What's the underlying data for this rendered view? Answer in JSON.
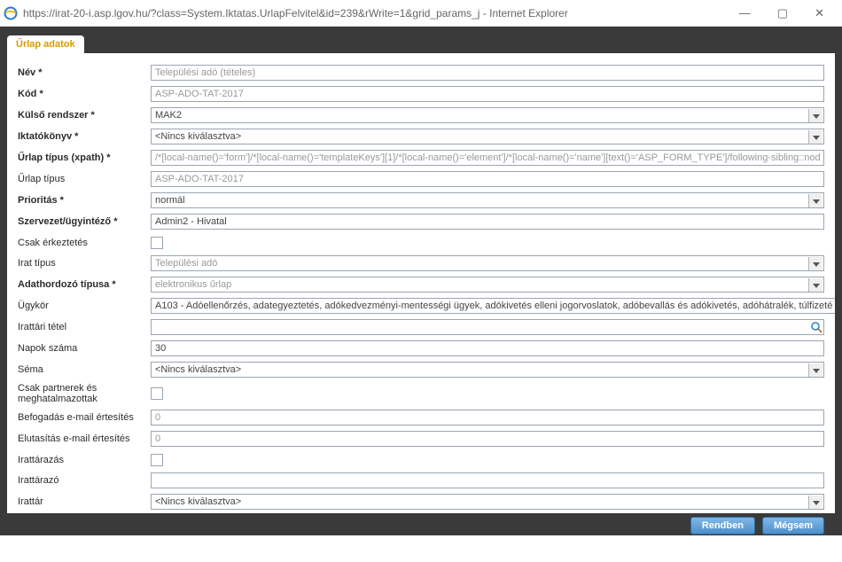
{
  "window": {
    "url_title": "https://irat-20-i.asp.lgov.hu/?class=System.Iktatas.UrlapFelvitel&id=239&rWrite=1&grid_params_j - Internet Explorer"
  },
  "tab": {
    "label": "Űrlap adatok"
  },
  "fields": {
    "nev": {
      "label": "Név *",
      "value": "Települési adó (tételes)"
    },
    "kod": {
      "label": "Kód *",
      "value": "ASP-ADO-TAT-2017"
    },
    "kulso": {
      "label": "Külső rendszer *",
      "value": "MAK2"
    },
    "iktatokonyv": {
      "label": "Iktatókönyv *",
      "value": "<Nincs kiválasztva>"
    },
    "urlap_xpath": {
      "label": "Űrlap típus (xpath) *",
      "value": "/*[local-name()='form']/*[local-name()='templateKeys'][1]/*[local-name()='element']/*[local-name()='name'][text()='ASP_FORM_TYPE']/following-sibling::node()"
    },
    "urlap_tipus": {
      "label": "Űrlap típus",
      "value": "ASP-ADO-TAT-2017"
    },
    "prioritas": {
      "label": "Prioritás *",
      "value": "normál"
    },
    "szervezet": {
      "label": "Szervezet/ügyintéző *",
      "value": "Admin2 - Hivatal"
    },
    "csak_erk": {
      "label": "Csak érkeztetés"
    },
    "irat_tipus": {
      "label": "Irat típus",
      "value": "Települési adó"
    },
    "adath": {
      "label": "Adathordozó típusa *",
      "value": "elektronikus űrlap"
    },
    "ugykor": {
      "label": "Ügykör",
      "value": "A103 - Adóellenőrzés, adategyeztetés, adókedvezményi-mentességi ügyek, adókivetés elleni jogorvoslatok, adóbevallás és adókivetés, adóhátralék, túlfizeté"
    },
    "irattari": {
      "label": "Irattári tétel",
      "value": ""
    },
    "napok": {
      "label": "Napok száma",
      "value": "30"
    },
    "sema": {
      "label": "Séma",
      "value": "<Nincs kiválasztva>"
    },
    "csak_part": {
      "label": "Csak partnerek és meghatalmazottak"
    },
    "befogadas": {
      "label": "Befogadás e-mail értesítés",
      "value": "0"
    },
    "elutasitas": {
      "label": "Elutasítás e-mail értesítés",
      "value": "0"
    },
    "irattarazas": {
      "label": "Irattárazás"
    },
    "irattarazo": {
      "label": "Irattárazó",
      "value": ""
    },
    "irattar": {
      "label": "Irattár",
      "value": "<Nincs kiválasztva>"
    }
  },
  "buttons": {
    "ok": "Rendben",
    "cancel": "Mégsem"
  }
}
